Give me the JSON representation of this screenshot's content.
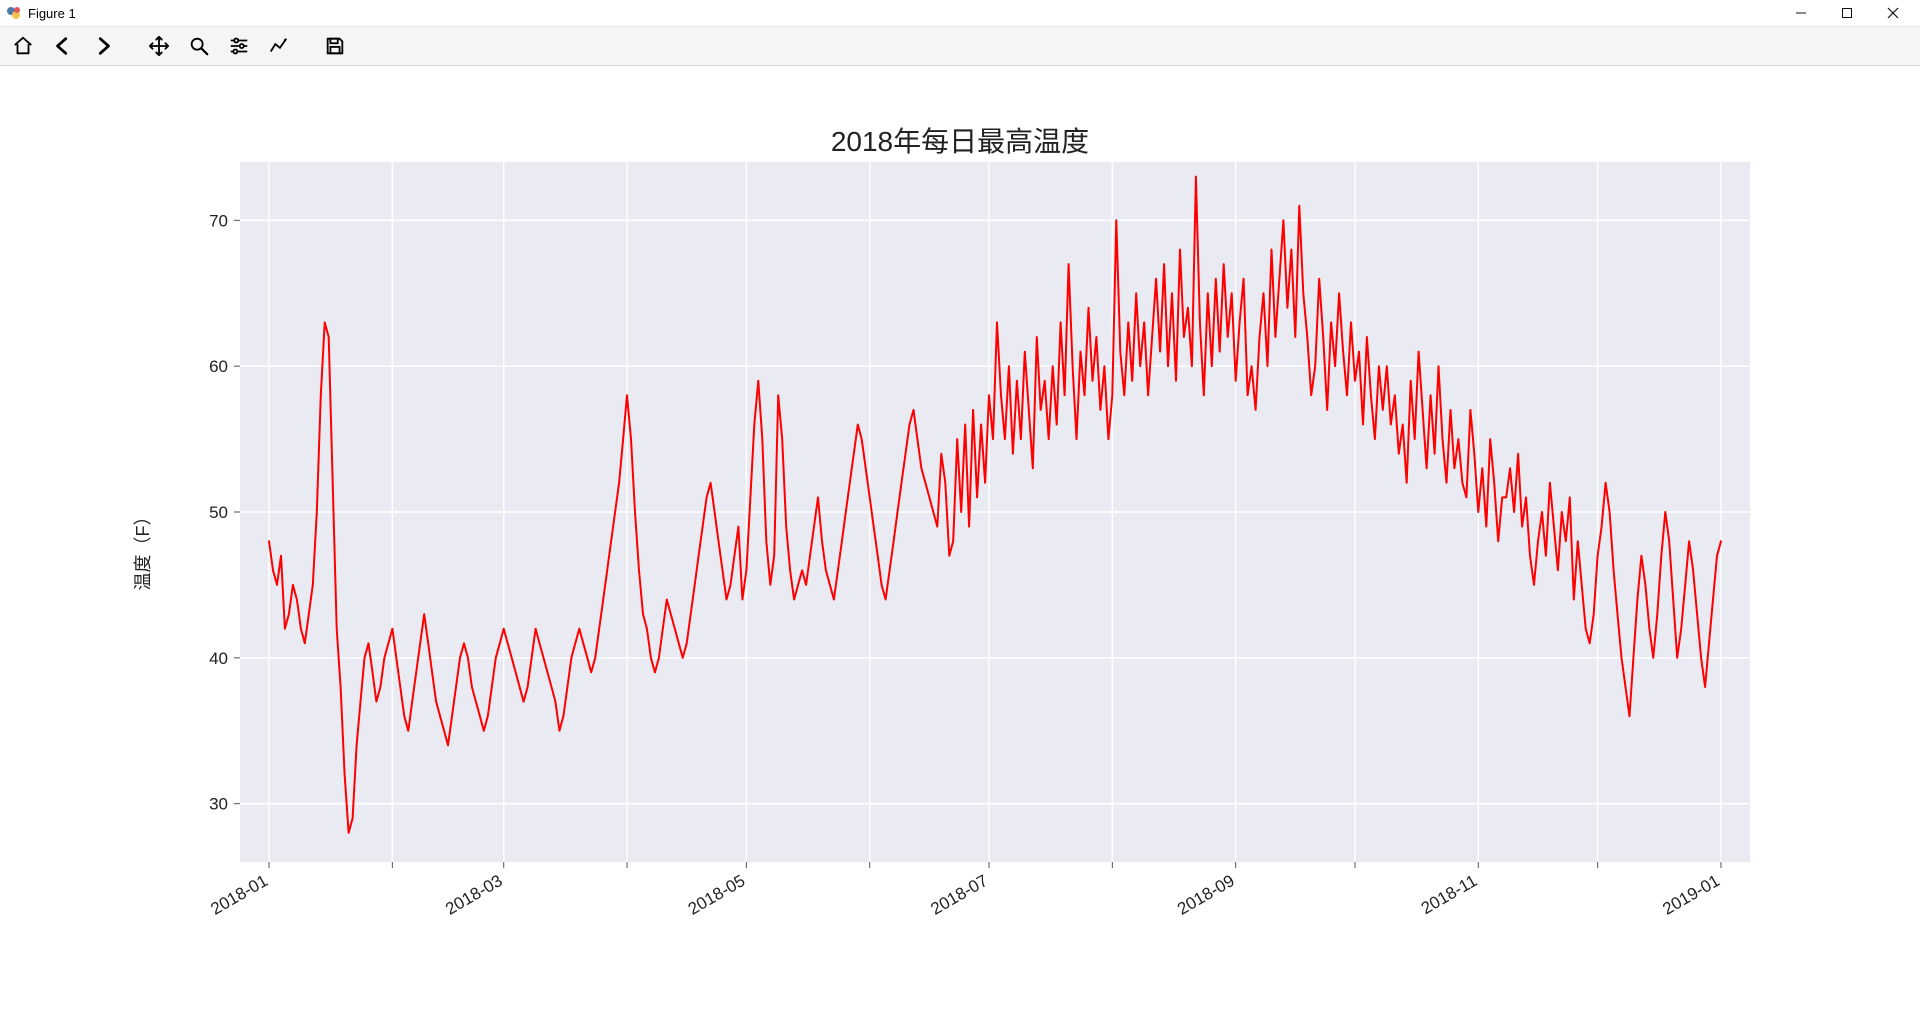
{
  "window": {
    "title": "Figure 1"
  },
  "toolbar": {
    "items": [
      {
        "name": "home-icon"
      },
      {
        "name": "back-icon"
      },
      {
        "name": "forward-icon"
      },
      {
        "name": "pan-icon"
      },
      {
        "name": "zoom-icon"
      },
      {
        "name": "subplots-icon"
      },
      {
        "name": "axes-edit-icon"
      },
      {
        "name": "save-icon"
      }
    ]
  },
  "chart_data": {
    "type": "line",
    "title": "2018年每日最高温度",
    "xlabel": "",
    "ylabel": "温度（F）",
    "x_ticks": [
      "2018-01",
      "2018-03",
      "2018-05",
      "2018-07",
      "2018-09",
      "2018-11",
      "2019-01"
    ],
    "y_ticks": [
      30,
      40,
      50,
      60,
      70
    ],
    "xlim": [
      "2018-01-01",
      "2019-01-01"
    ],
    "ylim": [
      26,
      74
    ],
    "line_color": "#ff0000",
    "plot_bg": "#eaeaf2",
    "grid_color": "#ffffff",
    "series": [
      {
        "name": "daily_high_F",
        "start_date": "2018-01-01",
        "values": [
          48,
          46,
          45,
          47,
          42,
          43,
          45,
          44,
          42,
          41,
          43,
          45,
          50,
          58,
          63,
          62,
          52,
          42,
          38,
          32,
          28,
          29,
          34,
          37,
          40,
          41,
          39,
          37,
          38,
          40,
          41,
          42,
          40,
          38,
          36,
          35,
          37,
          39,
          41,
          43,
          41,
          39,
          37,
          36,
          35,
          34,
          36,
          38,
          40,
          41,
          40,
          38,
          37,
          36,
          35,
          36,
          38,
          40,
          41,
          42,
          41,
          40,
          39,
          38,
          37,
          38,
          40,
          42,
          41,
          40,
          39,
          38,
          37,
          35,
          36,
          38,
          40,
          41,
          42,
          41,
          40,
          39,
          40,
          42,
          44,
          46,
          48,
          50,
          52,
          55,
          58,
          55,
          50,
          46,
          43,
          42,
          40,
          39,
          40,
          42,
          44,
          43,
          42,
          41,
          40,
          41,
          43,
          45,
          47,
          49,
          51,
          52,
          50,
          48,
          46,
          44,
          45,
          47,
          49,
          44,
          46,
          51,
          56,
          59,
          55,
          48,
          45,
          47,
          58,
          55,
          49,
          46,
          44,
          45,
          46,
          45,
          47,
          49,
          51,
          48,
          46,
          45,
          44,
          46,
          48,
          50,
          52,
          54,
          56,
          55,
          53,
          51,
          49,
          47,
          45,
          44,
          46,
          48,
          50,
          52,
          54,
          56,
          57,
          55,
          53,
          52,
          51,
          50,
          49,
          54,
          52,
          47,
          48,
          55,
          50,
          56,
          49,
          57,
          51,
          56,
          52,
          58,
          55,
          63,
          58,
          55,
          60,
          54,
          59,
          55,
          61,
          57,
          53,
          62,
          57,
          59,
          55,
          60,
          56,
          63,
          58,
          67,
          60,
          55,
          61,
          58,
          64,
          59,
          62,
          57,
          60,
          55,
          58,
          70,
          61,
          58,
          63,
          59,
          65,
          60,
          63,
          58,
          62,
          66,
          61,
          67,
          60,
          65,
          59,
          68,
          62,
          64,
          60,
          73,
          63,
          58,
          65,
          60,
          66,
          61,
          67,
          62,
          65,
          59,
          63,
          66,
          58,
          60,
          57,
          62,
          65,
          60,
          68,
          62,
          66,
          70,
          64,
          68,
          62,
          71,
          65,
          62,
          58,
          60,
          66,
          62,
          57,
          63,
          60,
          65,
          61,
          58,
          63,
          59,
          61,
          56,
          62,
          58,
          55,
          60,
          57,
          60,
          56,
          58,
          54,
          56,
          52,
          59,
          55,
          61,
          57,
          53,
          58,
          54,
          60,
          55,
          52,
          57,
          53,
          55,
          52,
          51,
          57,
          54,
          50,
          53,
          49,
          55,
          52,
          48,
          51,
          51,
          53,
          50,
          54,
          49,
          51,
          47,
          45,
          48,
          50,
          47,
          52,
          49,
          46,
          50,
          48,
          51,
          44,
          48,
          45,
          42,
          41,
          43,
          47,
          49,
          52,
          50,
          46,
          43,
          40,
          38,
          36,
          40,
          44,
          47,
          45,
          42,
          40,
          43,
          47,
          50,
          48,
          44,
          40,
          42,
          45,
          48,
          46,
          43,
          40,
          38,
          41,
          44,
          47,
          48
        ]
      }
    ]
  }
}
